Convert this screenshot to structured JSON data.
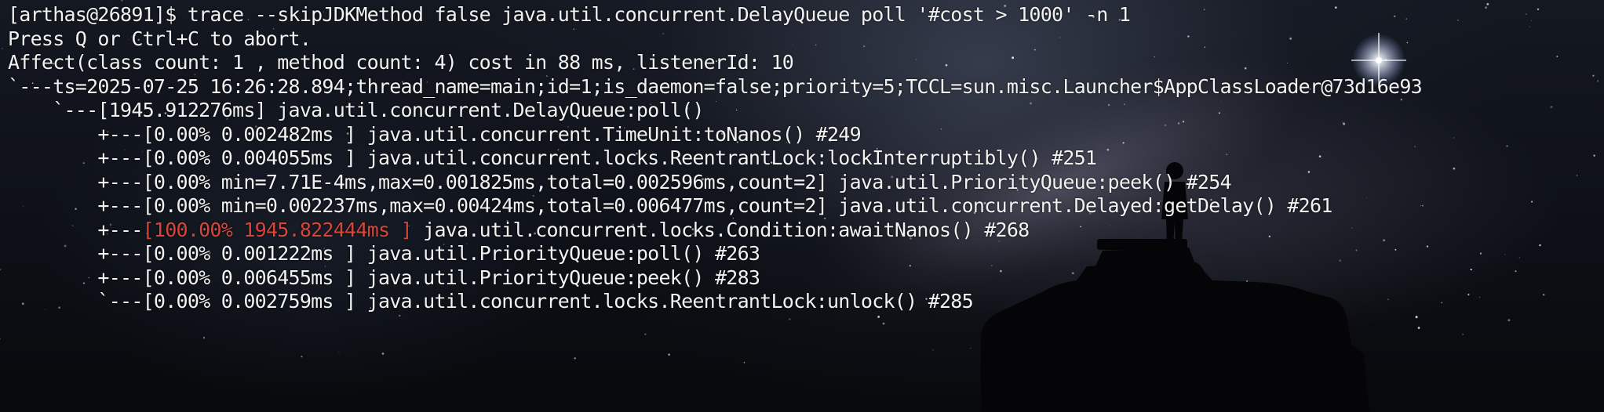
{
  "colors": {
    "text": "#f2f2f2",
    "highlight": "#d8463a",
    "sky": "#141821",
    "silhouette": "#050507"
  },
  "terminal": {
    "lines": [
      {
        "text": "[arthas@26891]$ trace --skipJDKMethod false java.util.concurrent.DelayQueue poll '#cost > 1000' -n 1"
      },
      {
        "text": "Press Q or Ctrl+C to abort."
      },
      {
        "text": "Affect(class count: 1 , method count: 4) cost in 88 ms, listenerId: 10"
      },
      {
        "text": "`---ts=2025-07-25 16:26:28.894;thread_name=main;id=1;is_daemon=false;priority=5;TCCL=sun.misc.Launcher$AppClassLoader@73d16e93"
      },
      {
        "text": "    `---[1945.912276ms] java.util.concurrent.DelayQueue:poll()"
      },
      {
        "text": "        +---[0.00% 0.002482ms ] java.util.concurrent.TimeUnit:toNanos() #249"
      },
      {
        "text": "        +---[0.00% 0.004055ms ] java.util.concurrent.locks.ReentrantLock:lockInterruptibly() #251"
      },
      {
        "text": "        +---[0.00% min=7.71E-4ms,max=0.001825ms,total=0.002596ms,count=2] java.util.PriorityQueue:peek() #254"
      },
      {
        "text": "        +---[0.00% min=0.002237ms,max=0.00424ms,total=0.006477ms,count=2] java.util.concurrent.Delayed:getDelay() #261"
      },
      {
        "prefix": "        +---",
        "highlight": "[100.00% 1945.822444ms ]",
        "suffix": " java.util.concurrent.locks.Condition:awaitNanos() #268"
      },
      {
        "text": "        +---[0.00% 0.001222ms ] java.util.PriorityQueue:poll() #263"
      },
      {
        "text": "        +---[0.00% 0.006455ms ] java.util.PriorityQueue:peek() #283"
      },
      {
        "text": "        `---[0.00% 0.002759ms ] java.util.concurrent.locks.ReentrantLock:unlock() #285"
      }
    ]
  }
}
